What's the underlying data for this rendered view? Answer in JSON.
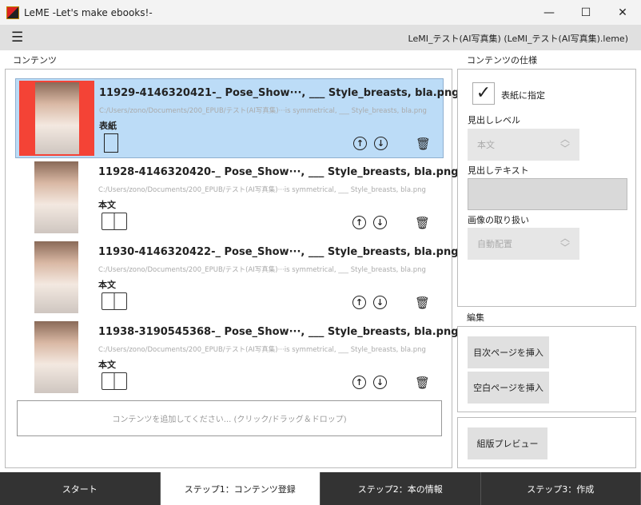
{
  "window": {
    "title": "LeME -Let's make ebooks!-",
    "minimize": "—",
    "maximize": "☐",
    "close": "✕"
  },
  "toolbar": {
    "menu_icon": "hamburger-icon",
    "project": "LeMI_テスト(AI写真集) (LeMI_テスト(AI写真集).leme)"
  },
  "contents": {
    "label": "コンテンツ",
    "add_placeholder": "コンテンツを追加してください... (クリック/ドラッグ＆ドロップ)",
    "items": [
      {
        "name": "11929-4146320421-_ Pose_Show···, ___ Style_breasts, bla.png",
        "path": "C:/Users/zono/Documents/200_EPUB/テスト(AI写真集)···is symmetrical, ___ Style_breasts, bla.png",
        "kind": "表紙",
        "selected": true
      },
      {
        "name": "11928-4146320420-_ Pose_Show···, ___ Style_breasts, bla.png",
        "path": "C:/Users/zono/Documents/200_EPUB/テスト(AI写真集)···is symmetrical, ___ Style_breasts, bla.png",
        "kind": "本文",
        "selected": false
      },
      {
        "name": "11930-4146320422-_ Pose_Show···, ___ Style_breasts, bla.png",
        "path": "C:/Users/zono/Documents/200_EPUB/テスト(AI写真集)···is symmetrical, ___ Style_breasts, bla.png",
        "kind": "本文",
        "selected": false
      },
      {
        "name": "11938-3190545368-_ Pose_Show···, ___ Style_breasts, bla.png",
        "path": "C:/Users/zono/Documents/200_EPUB/テスト(AI写真集)···is symmetrical, ___ Style_breasts, bla.png",
        "kind": "本文",
        "selected": false
      }
    ]
  },
  "spec": {
    "label": "コンテンツの仕様",
    "cover_check": "表紙に指定",
    "cover_checked": true,
    "heading_level_label": "見出しレベル",
    "heading_level": "本文",
    "heading_text_label": "見出しテキスト",
    "heading_text": "",
    "image_label": "画像の取り扱い",
    "image_mode": "自動配置"
  },
  "edit": {
    "label": "編集",
    "insert_toc": "目次ページを挿入",
    "insert_blank": "空白ページを挿入"
  },
  "preview": {
    "button": "組版プレビュー"
  },
  "tabs": [
    {
      "label": "スタート"
    },
    {
      "label": "ステップ1：コンテンツ登録",
      "active": true
    },
    {
      "label": "ステップ2：本の情報"
    },
    {
      "label": "ステップ3：作成"
    }
  ],
  "colors": {
    "selected": "#bcdcf7",
    "cover_bg": "#f44336",
    "tabbar": "#333333"
  }
}
